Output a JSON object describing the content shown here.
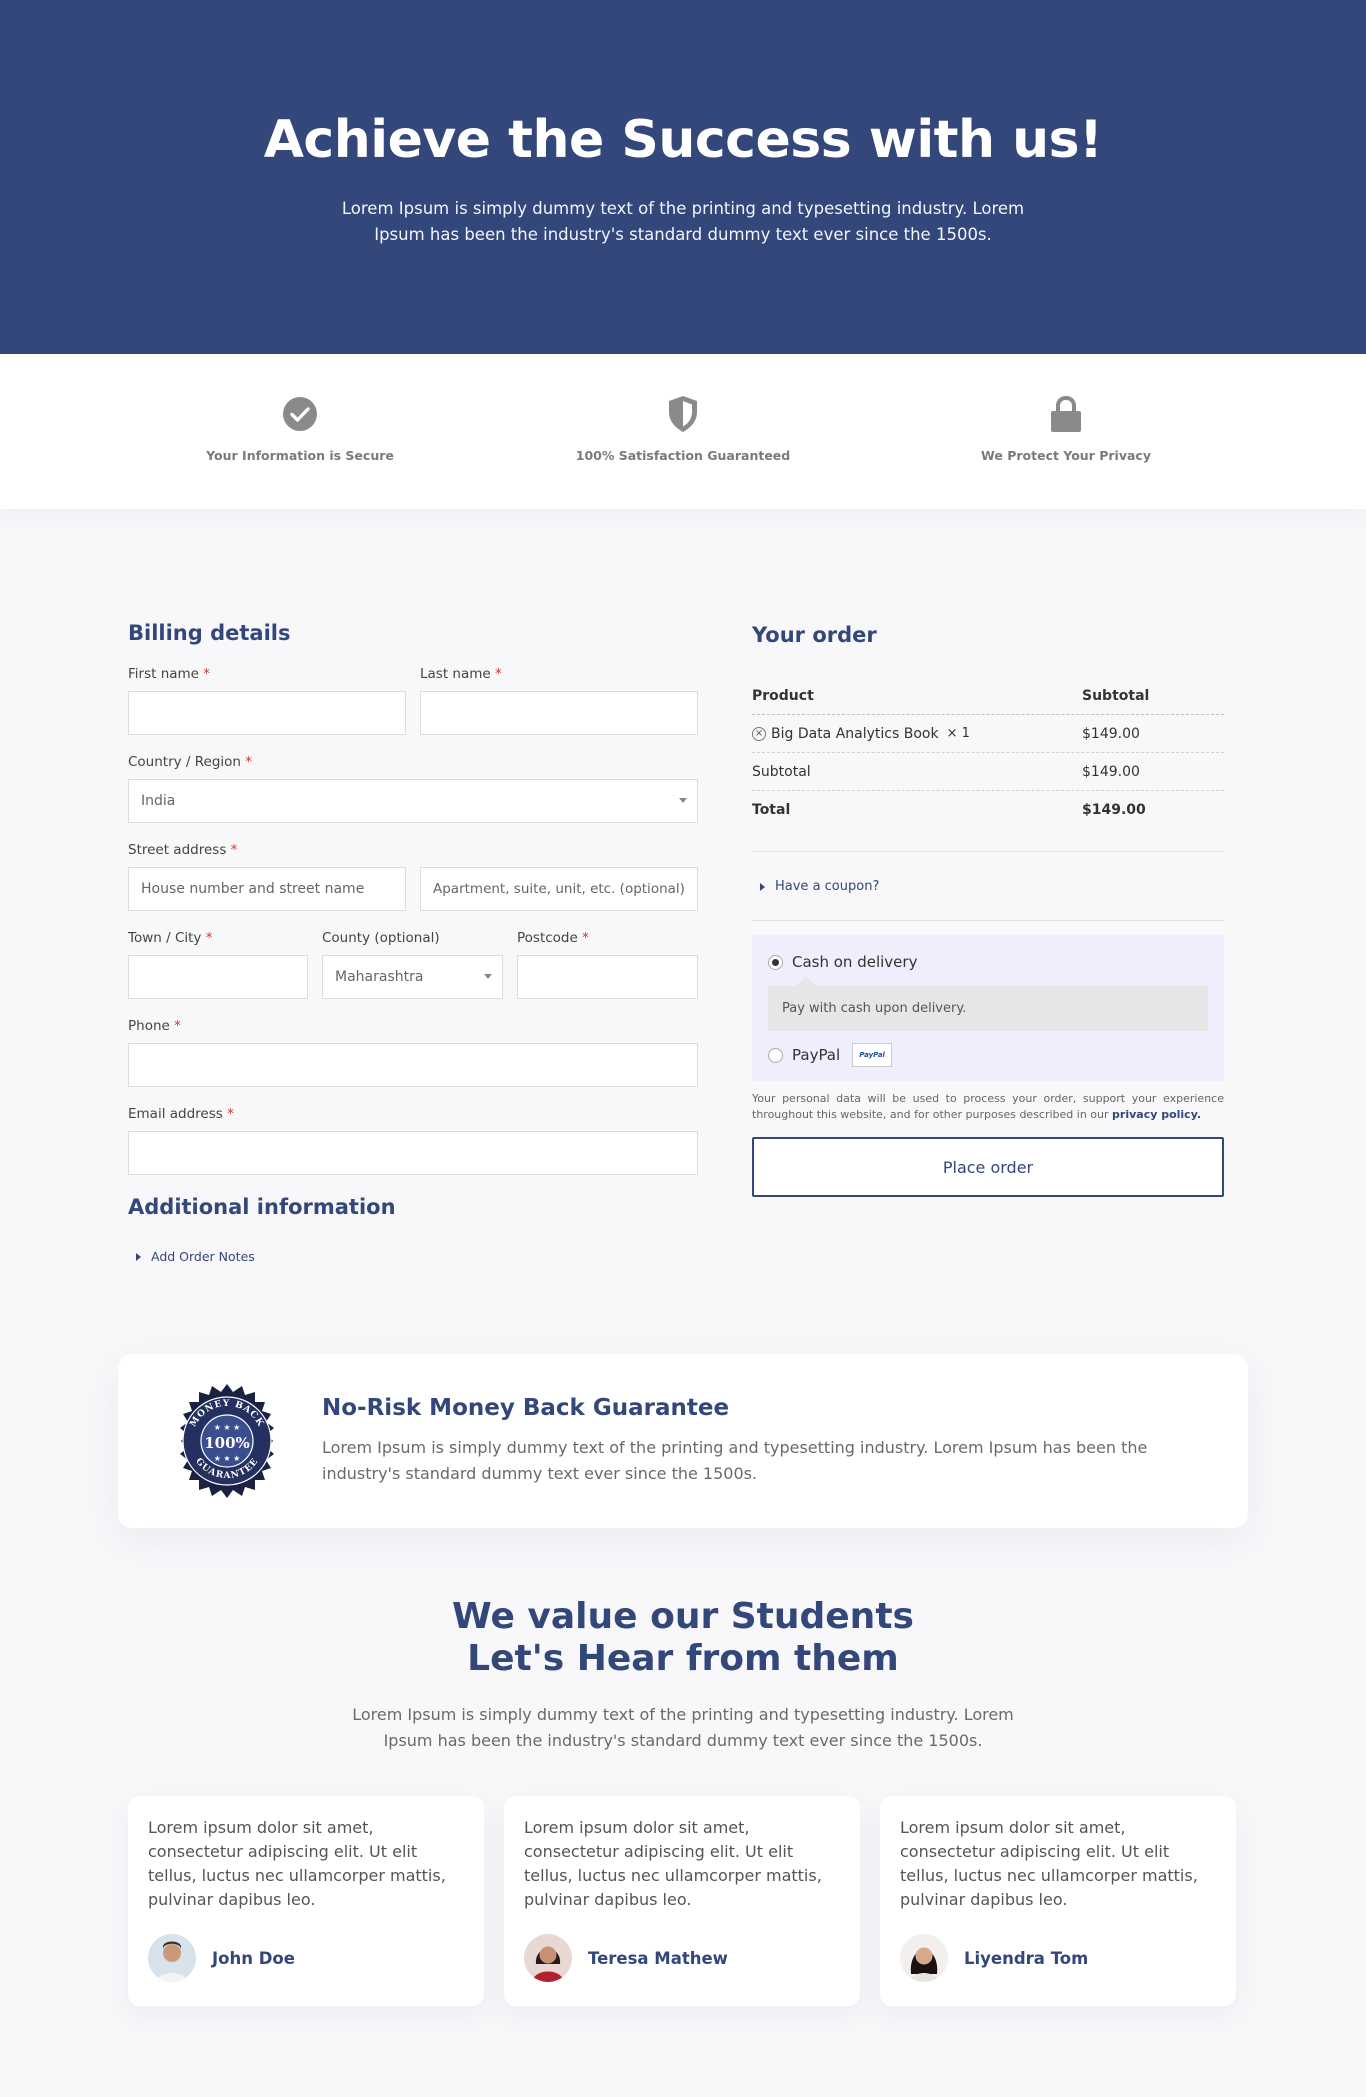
{
  "hero": {
    "title": "Achieve the Success with us!",
    "subtitle": "Lorem Ipsum is simply dummy text of the printing and typesetting industry. Lorem Ipsum has been the industry's standard dummy text ever since the 1500s."
  },
  "trust": [
    {
      "label": "Your Information is Secure",
      "icon": "check-circle-icon"
    },
    {
      "label": "100% Satisfaction Guaranteed",
      "icon": "shield-icon"
    },
    {
      "label": "We Protect Your Privacy",
      "icon": "lock-icon"
    }
  ],
  "billing": {
    "title": "Billing details",
    "first_name": "First name",
    "last_name": "Last name",
    "country_label": "Country / Region",
    "country_value": "India",
    "street_label": "Street address",
    "street_placeholder": "House number and street name",
    "apt_placeholder": "Apartment, suite, unit, etc. (optional)",
    "town_label": "Town / City",
    "county_label": "County (optional)",
    "county_value": "Maharashtra",
    "postcode_label": "Postcode",
    "phone_label": "Phone",
    "email_label": "Email address",
    "required_mark": "*"
  },
  "additional": {
    "title": "Additional information",
    "notes_link": "Add Order Notes"
  },
  "order": {
    "title": "Your order",
    "col_product": "Product",
    "col_subtotal": "Subtotal",
    "item_name": "Big Data Analytics Book",
    "item_qty": "× 1",
    "item_price": "$149.00",
    "subtotal_label": "Subtotal",
    "subtotal_value": "$149.00",
    "total_label": "Total",
    "total_value": "$149.00",
    "coupon": "Have a coupon?",
    "pay_cod": "Cash on delivery",
    "pay_cod_desc": "Pay with cash upon delivery.",
    "pay_paypal": "PayPal",
    "paypal_logo": "PayPal",
    "privacy_text": "Your personal data will be used to process your order, support your experience throughout this website, and for other purposes described in our",
    "privacy_link": "privacy policy.",
    "place_order": "Place order"
  },
  "guarantee": {
    "title": "No-Risk Money Back Guarantee",
    "desc": "Lorem Ipsum is simply dummy text of the printing and typesetting industry. Lorem Ipsum has been the industry's standard dummy text ever since the 1500s.",
    "badge_top": "MONEY BACK",
    "badge_mid": "100%",
    "badge_bottom": "GUARANTEE"
  },
  "students": {
    "title_line1": "We value our Students",
    "title_line2": "Let's Hear from them",
    "desc": "Lorem Ipsum is simply dummy text of the printing and typesetting industry. Lorem Ipsum has been the industry's standard dummy text ever since the 1500s."
  },
  "testimonials": [
    {
      "quote": "Lorem ipsum dolor sit amet, consectetur adipiscing elit. Ut elit tellus, luctus nec ullamcorper mattis, pulvinar dapibus leo.",
      "name": "John Doe"
    },
    {
      "quote": "Lorem ipsum dolor sit amet, consectetur adipiscing elit. Ut elit tellus, luctus nec ullamcorper mattis, pulvinar dapibus leo.",
      "name": "Teresa Mathew"
    },
    {
      "quote": "Lorem ipsum dolor sit amet, consectetur adipiscing elit. Ut elit tellus, luctus nec ullamcorper mattis, pulvinar dapibus leo.",
      "name": "Liyendra Tom"
    }
  ],
  "colors": {
    "brand": "#34477a",
    "required": "#e02b2b",
    "payment_bg": "#eeeefc"
  }
}
